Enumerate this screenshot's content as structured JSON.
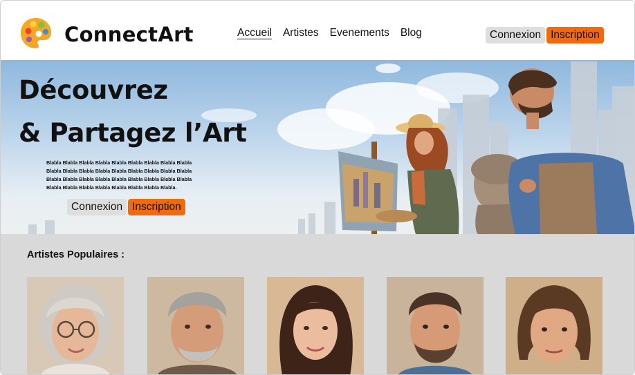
{
  "header": {
    "brand": "ConnectArt",
    "nav": [
      {
        "label": "Accueil",
        "active": true
      },
      {
        "label": "Artistes",
        "active": false
      },
      {
        "label": "Evenements",
        "active": false
      },
      {
        "label": "Blog",
        "active": false
      }
    ],
    "login_label": "Connexion",
    "signup_label": "Inscription"
  },
  "hero": {
    "title_line1": "Découvrez",
    "title_line2": "& Partagez l’Art",
    "body_lines": [
      "Blabla Blabla Blabla Blabla Blabla Blabla Blabla Blabla Blabla",
      "Blabla Blabla Blabla Blabla Blabla Blabla Blabla Blabla Blabla",
      "Blabla Blabla Blabla Blabla Blabla Blabla Blabla Blabla Blabla",
      "Blabla Blabla Blabla Blabla Blabla Blabla Blabla Blabla."
    ],
    "login_label": "Connexion",
    "signup_label": "Inscription"
  },
  "artists": {
    "title": "Artistes Populaires :"
  },
  "colors": {
    "accent": "#f26a0e",
    "button_light": "#dedede",
    "section_bg": "#d9d9d9"
  },
  "icons": {
    "logo": "palette-icon"
  }
}
